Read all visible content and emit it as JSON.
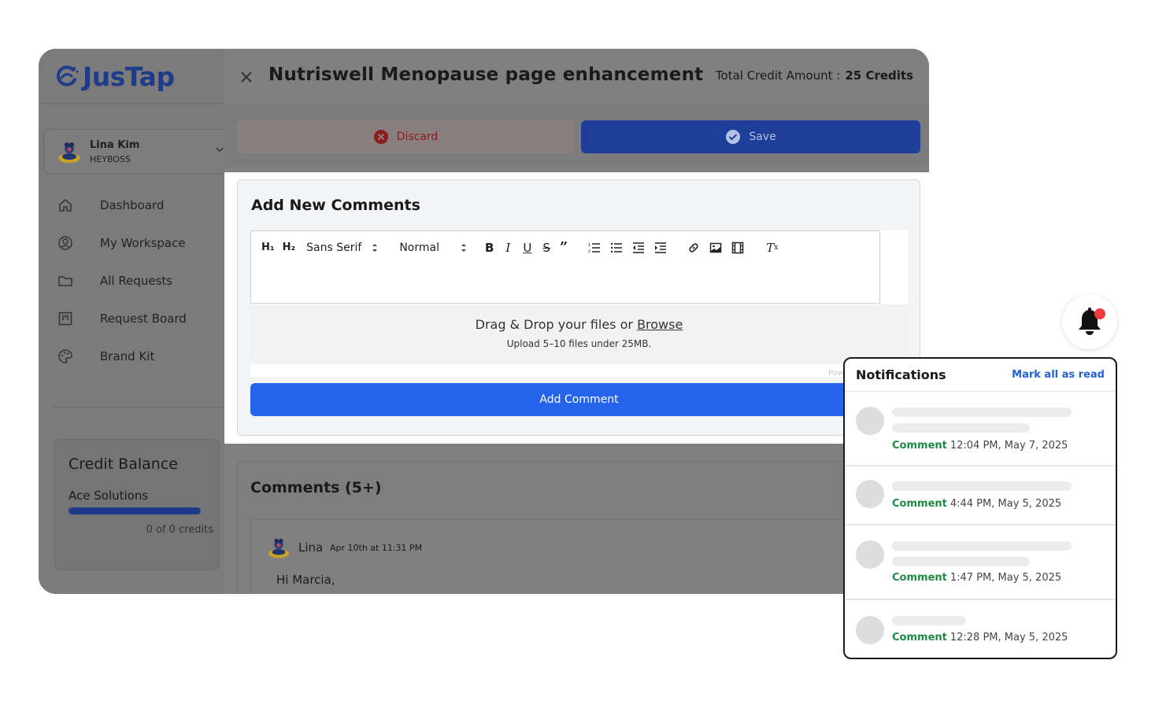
{
  "app": {
    "brand": "JusTap",
    "colors": {
      "brand": "#1f3c8a",
      "primary": "#2563eb",
      "danger": "#b91c1c",
      "notify_dot": "#ef3b3b",
      "comment_green": "#1f8a46"
    }
  },
  "sidebar": {
    "user": {
      "name": "Lina Kim",
      "role": "HEYBOSS"
    },
    "nav": [
      {
        "label": "Dashboard",
        "icon": "home-icon"
      },
      {
        "label": "My Workspace",
        "icon": "user-circle-icon"
      },
      {
        "label": "All Requests",
        "icon": "folder-icon"
      },
      {
        "label": "Request Board",
        "icon": "board-icon"
      },
      {
        "label": "Brand Kit",
        "icon": "palette-icon"
      }
    ],
    "credit": {
      "title": "Credit Balance",
      "company": "Ace Solutions",
      "count": "0 of 0 credits"
    }
  },
  "modal": {
    "title": "Nutriswell Menopause page enhancement",
    "credit_label": "Total Credit Amount :",
    "credit_value": "25 Credits",
    "discard_label": "Discard",
    "save_label": "Save"
  },
  "new_comment": {
    "title": "Add New Comments",
    "toolbar": {
      "h1": "H₁",
      "h2": "H₂",
      "font": "Sans Serif",
      "size": "Normal"
    },
    "drop_text": "Drag & Drop your files or",
    "drop_browse": "Browse",
    "drop_sub": "Upload 5–10 files under 25MB.",
    "powered": "Pow",
    "button": "Add Comment"
  },
  "comments": {
    "title": "Comments (5+)",
    "first": {
      "author": "Lina",
      "time": "Apr 10th at 11:31 PM",
      "body": "Hi Marcia,"
    }
  },
  "notifications": {
    "title": "Notifications",
    "mark_all": "Mark all as read",
    "items": [
      {
        "kind": "Comment",
        "time": "12:04 PM, May 7, 2025"
      },
      {
        "kind": "Comment",
        "time": "4:44 PM, May 5, 2025"
      },
      {
        "kind": "Comment",
        "time": "1:47 PM, May 5, 2025"
      },
      {
        "kind": "Comment",
        "time": "12:28 PM, May 5, 2025"
      }
    ]
  }
}
